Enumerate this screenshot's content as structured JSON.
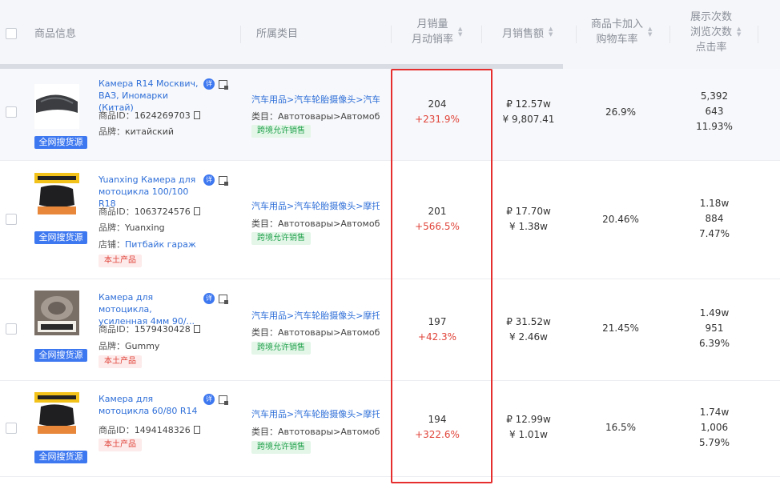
{
  "header": {
    "product_info": "商品信息",
    "category": "所属类目",
    "monthly_sales": "月销量",
    "monthly_rate": "月动销率",
    "monthly_revenue": "月销售额",
    "cart_rate_line1": "商品卡加入",
    "cart_rate_line2": "购物车率",
    "impressions": "展示次数",
    "views": "浏览次数",
    "ctr": "点击率"
  },
  "labels": {
    "source_badge": "全网搜货源",
    "detail_icon": "详",
    "id_label": "商品ID：",
    "brand_label": "品牌：",
    "shop_label": "店铺：",
    "category_label": "类目：",
    "local_tag": "本土产品",
    "cross_border_tag": "跨境允许销售"
  },
  "rows": [
    {
      "name": "Камера R14 Москвич, ВАЗ, Иномарки (Китай)",
      "id": "1624269703",
      "brand": "китайский",
      "category_path": "汽车用品>汽车轮胎摄像头>汽车配件",
      "category_type": "Автотовары>Автомобильные шины",
      "sales": "204",
      "sales_rate": "+231.9%",
      "rev_rub": "₽ 12.57w",
      "rev_cny": "¥ 9,807.41",
      "cart_rate": "26.9%",
      "impressions": "5,392",
      "views": "643",
      "ctr": "11.93%"
    },
    {
      "name": "Yuanxing Камера для мотоцикла 100/100 R18",
      "id": "1063724576",
      "brand": "Yuanxing",
      "shop": "Питбайк гараж",
      "local": "本土产品",
      "category_path": "汽车用品>汽车轮胎摄像头>摩托车",
      "category_type": "Автотовары>Автомобильные шины",
      "sales": "201",
      "sales_rate": "+566.5%",
      "rev_rub": "₽ 17.70w",
      "rev_cny": "¥ 1.38w",
      "cart_rate": "20.46%",
      "impressions": "1.18w",
      "views": "884",
      "ctr": "7.47%"
    },
    {
      "name": "Камера для мотоцикла, усиленная 4мм 90/...",
      "id": "1579430428",
      "brand": "Gummy",
      "local": "本土产品",
      "category_path": "汽车用品>汽车轮胎摄像头>摩托车",
      "category_type": "Автотовары>Автомобильные шины",
      "sales": "197",
      "sales_rate": "+42.3%",
      "rev_rub": "₽ 31.52w",
      "rev_cny": "¥ 2.46w",
      "cart_rate": "21.45%",
      "impressions": "1.49w",
      "views": "951",
      "ctr": "6.39%"
    },
    {
      "name": "Камера для мотоцикла 60/80 R14",
      "id": "1494148326",
      "local": "本土产品",
      "category_path": "汽车用品>汽车轮胎摄像头>摩托车",
      "category_type": "Автотовары>Автомобильные шины",
      "sales": "194",
      "sales_rate": "+322.6%",
      "rev_rub": "₽ 12.99w",
      "rev_cny": "¥ 1.01w",
      "cart_rate": "16.5%",
      "impressions": "1.74w",
      "views": "1,006",
      "ctr": "5.79%"
    }
  ],
  "images": {
    "row1": "black-inner-tube",
    "row2": "tube-box-yellow-label",
    "row3": "tube-with-label-80-90-r21",
    "row4": "tube-box-yellow-label"
  },
  "colors": {
    "link": "#2f6fd8",
    "accent": "#3e78f0",
    "increase": "#e0443a",
    "highlight_border": "#e62e2e",
    "header_bg": "#f5f6f9"
  }
}
